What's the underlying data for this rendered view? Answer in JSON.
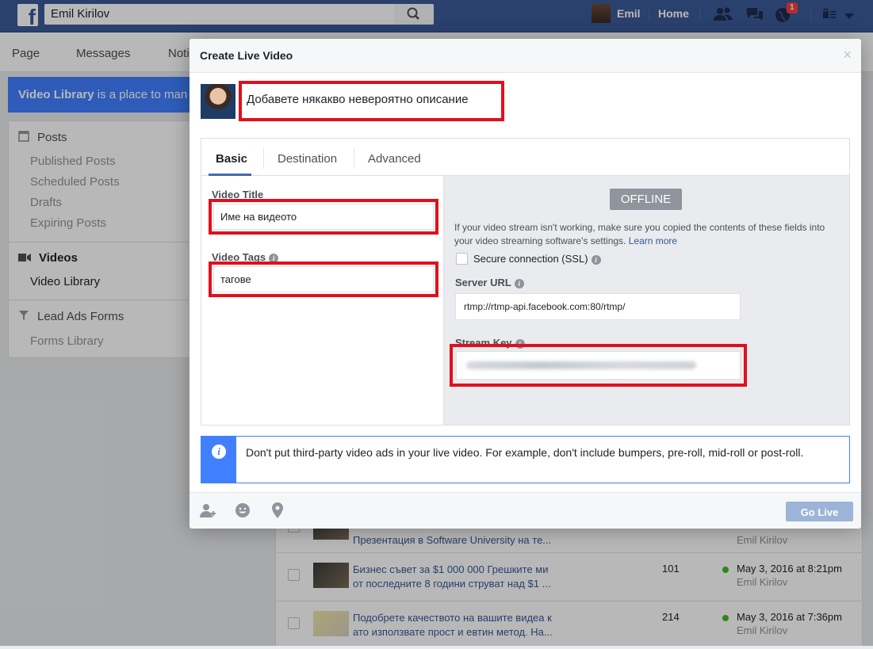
{
  "topbar": {
    "search_value": "Emil Kirilov",
    "user_name": "Emil",
    "home_label": "Home",
    "notification_count": "1"
  },
  "subnav": {
    "items": [
      "Page",
      "Messages",
      "Noti"
    ]
  },
  "banner": {
    "bold": "Video Library",
    "rest": " is a place to man"
  },
  "sidebar": {
    "posts_header": "Posts",
    "posts_items": [
      "Published Posts",
      "Scheduled Posts",
      "Drafts",
      "Expiring Posts"
    ],
    "videos_header": "Videos",
    "video_library": "Video Library",
    "lead_ads_header": "Lead Ads Forms",
    "forms_library": "Forms Library"
  },
  "table": {
    "rows": [
      {
        "title": "Презентация в Software University на те...",
        "count": "",
        "date": "",
        "author": "Emil Kirilov"
      },
      {
        "title": "Бизнес съвет за $1 000 000 Грешките ми от последните 8 години струват над $1 ...",
        "count": "101",
        "date": "May 3, 2016 at 8:21pm",
        "author": "Emil Kirilov"
      },
      {
        "title": "Подобрете качеството на вашите видеа к ато използвате прост и евтин метод. На...",
        "count": "214",
        "date": "May 3, 2016 at 7:36pm",
        "author": "Emil Kirilov"
      }
    ]
  },
  "modal": {
    "title": "Create Live Video",
    "close": "×",
    "description": "Добавете някакво невероятно описание",
    "tabs": [
      "Basic",
      "Destination",
      "Advanced"
    ],
    "video_title_label": "Video Title",
    "video_title_value": "Име на видеото",
    "video_tags_label": "Video Tags",
    "video_tags_value": "тагове",
    "status": "OFFLINE",
    "help_text": "If your video stream isn't working, make sure you copied the contents of these fields into your video streaming software's settings.",
    "learn_more": "Learn more",
    "ssl_label": "Secure connection (SSL)",
    "server_url_label": "Server URL",
    "server_url_value": "rtmp://rtmp-api.facebook.com:80/rtmp/",
    "stream_key_label": "Stream Key",
    "notice": "Don't put third-party video ads in your live video. For example, don't include bumpers, pre-roll, mid-roll or post-roll.",
    "go_live": "Go Live"
  },
  "colors": {
    "fb_blue": "#3b5998",
    "highlight_red": "#e0101c",
    "info_blue": "#4080ff"
  }
}
